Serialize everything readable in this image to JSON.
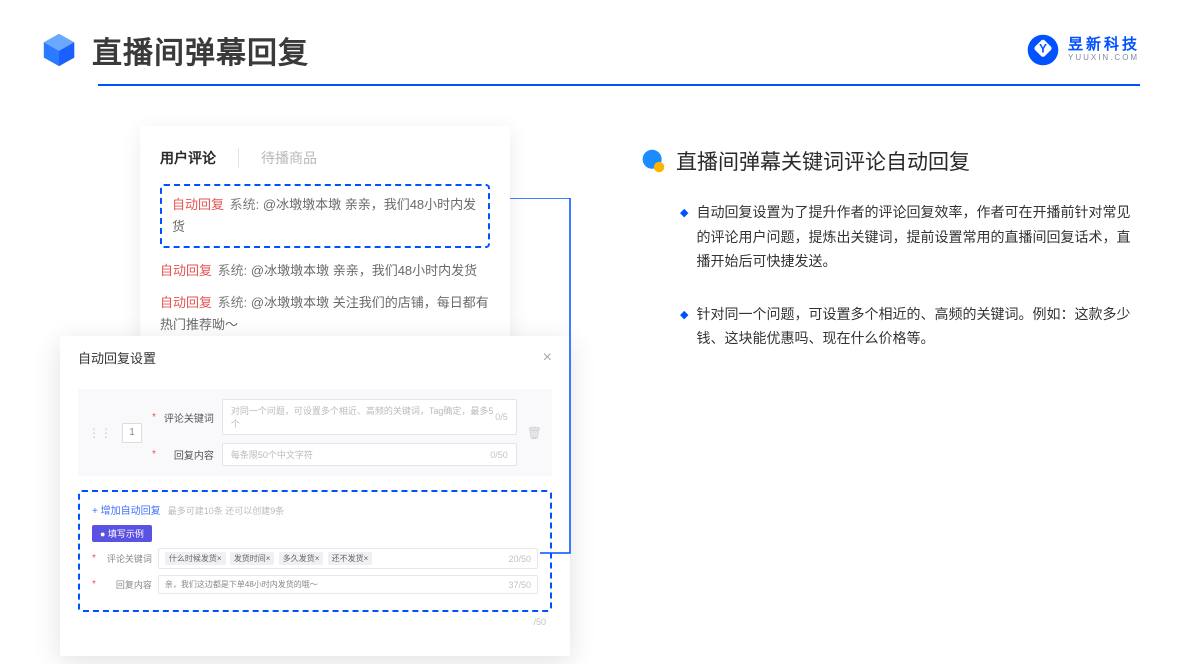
{
  "header": {
    "title": "直播间弹幕回复",
    "logo_cn": "昱新科技",
    "logo_en": "YUUXIN.COM"
  },
  "comment_card": {
    "tab_active": "用户评论",
    "tab_inactive": "待播商品",
    "highlighted_prefix": "自动回复",
    "highlighted_sys": "系统:",
    "highlighted_text": "@冰墩墩本墩 亲亲，我们48小时内发货",
    "line2_prefix": "自动回复",
    "line2_sys": "系统:",
    "line2_text": "@冰墩墩本墩 亲亲，我们48小时内发货",
    "line3_prefix": "自动回复",
    "line3_sys": "系统:",
    "line3_text": "@冰墩墩本墩 关注我们的店铺，每日都有热门推荐呦～"
  },
  "settings": {
    "modal_title": "自动回复设置",
    "close": "×",
    "index": "1",
    "keyword_label": "评论关键词",
    "keyword_placeholder": "对同一个问题，可设置多个相近、高频的关键词，Tag确定，最多5个",
    "keyword_counter": "0/5",
    "content_label": "回复内容",
    "content_placeholder": "每条限50个中文字符",
    "content_counter": "0/50",
    "add_link": "+ 增加自动回复",
    "add_hint": "最多可建10条 还可以创建9条",
    "example_badge": "● 填写示例",
    "ex_keyword_label": "评论关键词",
    "tag1": "什么时候发货×",
    "tag2": "发货时间×",
    "tag3": "多久发货×",
    "tag4": "还不发货×",
    "ex_kw_counter": "20/50",
    "ex_content_label": "回复内容",
    "ex_content_value": "亲，我们这边都是下单48小时内发货的哦～",
    "ex_content_counter": "37/50",
    "outer_counter": "/50"
  },
  "right": {
    "section_title": "直播间弹幕关键词评论自动回复",
    "bullet1": "自动回复设置为了提升作者的评论回复效率，作者可在开播前针对常见的评论用户问题，提炼出关键词，提前设置常用的直播间回复话术，直播开始后可快捷发送。",
    "bullet2": "针对同一个问题，可设置多个相近的、高频的关键词。例如：这款多少钱、这块能优惠吗、现在什么价格等。"
  }
}
